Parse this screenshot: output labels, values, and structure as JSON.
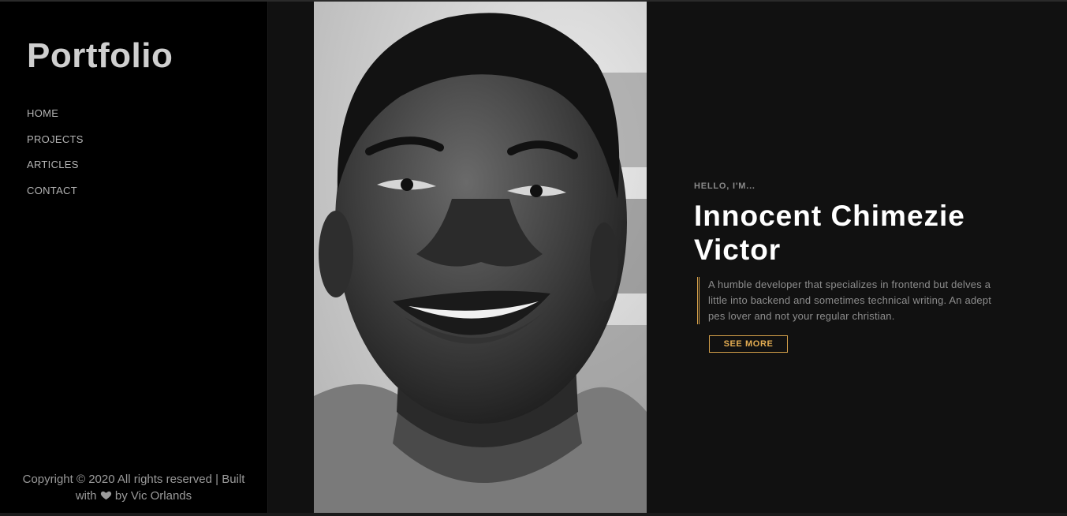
{
  "sidebar": {
    "brand": "Portfolio",
    "nav": [
      {
        "label": "HOME"
      },
      {
        "label": "PROJECTS"
      },
      {
        "label": "ARTICLES"
      },
      {
        "label": "CONTACT"
      }
    ],
    "footer": {
      "copyright": "Copyright © 2020 All rights reserved | Built",
      "with": "with",
      "icon": "heart-icon",
      "by": "by Vic Orlands"
    }
  },
  "hero": {
    "photo_alt": "portrait-photo",
    "greeting": "HELLO, I'M...",
    "name_line1": "Innocent Chimezie",
    "name_line2": "Victor",
    "bio": "A humble developer that specializes in frontend but delves a little into backend and sometimes technical writing. An adept pes lover and not your regular christian.",
    "cta": "SEE MORE"
  },
  "colors": {
    "accent": "#d4a04a",
    "background": "#111111",
    "sidebar": "#000000"
  }
}
